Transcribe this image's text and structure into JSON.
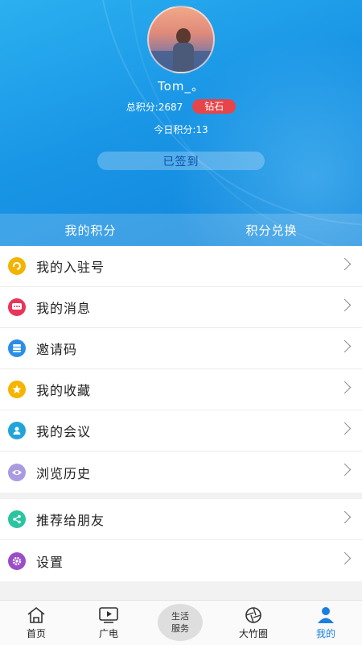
{
  "profile": {
    "username": "Tom_。",
    "total_points": "总积分:2687",
    "level_badge": "钻石",
    "today_points": "今日积分:13",
    "sign_status": "已签到"
  },
  "tabs": [
    {
      "label": "我的积分"
    },
    {
      "label": "积分兑换"
    }
  ],
  "menu": [
    {
      "label": "我的入驻号",
      "icon": "arrow-swirl-icon",
      "color": "#f2b400"
    },
    {
      "label": "我的消息",
      "icon": "chat-icon",
      "color": "#e8355a"
    },
    {
      "label": "邀请码",
      "icon": "layers-icon",
      "color": "#2a8ee8"
    },
    {
      "label": "我的收藏",
      "icon": "star-icon",
      "color": "#f5b400"
    },
    {
      "label": "我的会议",
      "icon": "people-icon",
      "color": "#22a4d8"
    },
    {
      "label": "浏览历史",
      "icon": "eye-icon",
      "color": "#a89be0"
    }
  ],
  "menu2": [
    {
      "label": "推荐给朋友",
      "icon": "share-icon",
      "color": "#2bc4a0"
    },
    {
      "label": "设置",
      "icon": "gear-icon",
      "color": "#9a4ec8"
    }
  ],
  "nav": {
    "home": "首页",
    "broadcast": "广电",
    "service_line1": "生活",
    "service_line2": "服务",
    "circle": "大竹圈",
    "mine": "我的"
  },
  "colors": {
    "header_blue": "#1a96e6",
    "badge_red": "#e6454a",
    "active_nav": "#1a7fe0"
  }
}
